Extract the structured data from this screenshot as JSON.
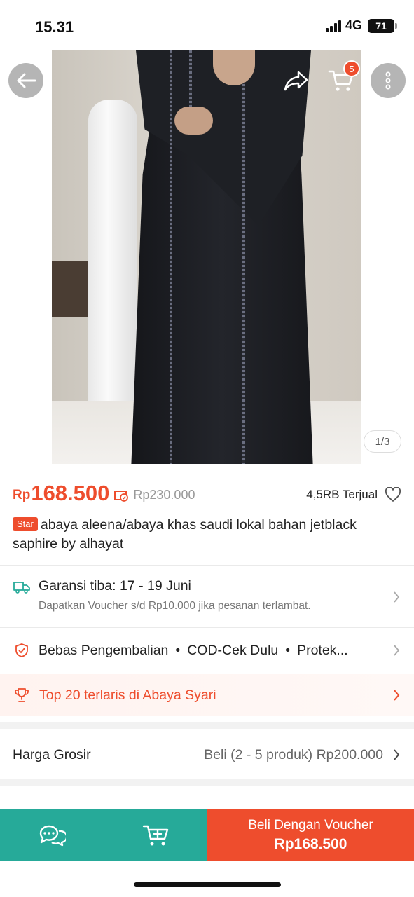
{
  "status_bar": {
    "time": "15.31",
    "network": "4G",
    "battery": "71"
  },
  "image": {
    "counter": "1/3",
    "cart_count": "5"
  },
  "product": {
    "price_currency": "Rp",
    "price": "168.500",
    "original_price": "Rp230.000",
    "sold": "4,5RB Terjual",
    "badge": "Star",
    "title": "abaya aleena/abaya khas saudi lokal bahan jetblack saphire by alhayat"
  },
  "shipping": {
    "title": "Garansi tiba: 17 - 19 Juni",
    "subtitle": "Dapatkan Voucher s/d Rp10.000 jika pesanan terlambat."
  },
  "guarantees": {
    "items": [
      "Bebas Pengembalian",
      "COD-Cek Dulu",
      "Protek..."
    ]
  },
  "ranking": {
    "text": "Top 20 terlaris di Abaya Syari"
  },
  "wholesale": {
    "label": "Harga Grosir",
    "value": "Beli (2 - 5 produk) Rp200.000"
  },
  "bottom_bar": {
    "buy_label": "Beli Dengan Voucher",
    "buy_price": "Rp168.500"
  },
  "colors": {
    "accent": "#ee4d2d",
    "teal": "#26aa99"
  },
  "icons": [
    "back-arrow-icon",
    "share-icon",
    "cart-icon",
    "more-icon",
    "voucher-icon",
    "heart-icon",
    "truck-icon",
    "shield-icon",
    "trophy-icon",
    "chevron-right-icon",
    "chat-icon",
    "add-to-cart-icon"
  ]
}
